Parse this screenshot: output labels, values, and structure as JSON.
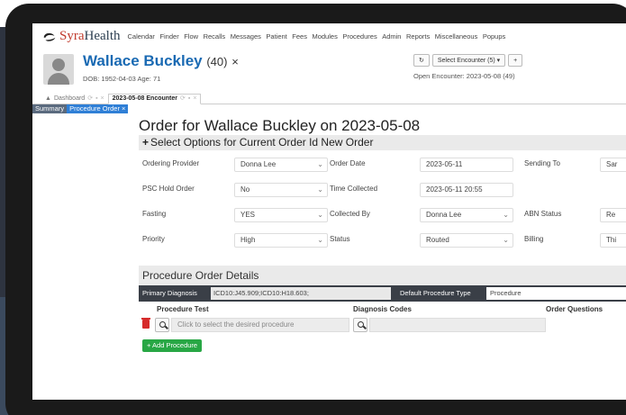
{
  "brand": {
    "syra": "Syra",
    "health": "Health"
  },
  "menu": [
    "Calendar",
    "Finder",
    "Flow",
    "Recalls",
    "Messages",
    "Patient",
    "Fees",
    "Modules",
    "Procedures",
    "Admin",
    "Reports",
    "Miscellaneous",
    "Popups"
  ],
  "patient": {
    "name": "Wallace Buckley",
    "age": "(40)",
    "close": "×",
    "dob": "DOB: 1952-04-03 Age: 71"
  },
  "encounter": {
    "select_label": "Select Encounter (5) ▾",
    "plus": "+",
    "open": "Open Encounter: 2023-05-08 (49)"
  },
  "tabs": [
    {
      "label": "Dashboard"
    },
    {
      "label": "2023-05-08 Encounter"
    }
  ],
  "subtabs": [
    "Summary",
    "Procedure Order ×"
  ],
  "order": {
    "title": "Order for Wallace Buckley on 2023-05-08",
    "section1": "Select Options for Current Order Id New Order",
    "fields": {
      "ordering_provider": {
        "label": "Ordering Provider",
        "value": "Donna Lee"
      },
      "order_date": {
        "label": "Order Date",
        "value": "2023-05-11"
      },
      "sending_to": {
        "label": "Sending To",
        "value": "Sar"
      },
      "psc_hold": {
        "label": "PSC Hold Order",
        "value": "No"
      },
      "time_collected": {
        "label": "Time Collected",
        "value": "2023-05-11 20:55"
      },
      "fasting": {
        "label": "Fasting",
        "value": "YES"
      },
      "collected_by": {
        "label": "Collected By",
        "value": "Donna Lee"
      },
      "abn_status": {
        "label": "ABN Status",
        "value": "Re"
      },
      "priority": {
        "label": "Priority",
        "value": "High"
      },
      "status": {
        "label": "Status",
        "value": "Routed"
      },
      "billing": {
        "label": "Billing",
        "value": "Thi"
      }
    },
    "section2": "Procedure Order Details",
    "primary_diagnosis": {
      "label": "Primary Diagnosis",
      "value": "ICD10:J45.909;ICD10:H18.603;"
    },
    "default_type": {
      "label": "Default Procedure Type",
      "value": "Procedure"
    },
    "columns": [
      "Procedure Test",
      "Diagnosis Codes",
      "Order Questions"
    ],
    "procedure_placeholder": "Click to select the desired procedure",
    "add_button": "+ Add Procedure"
  },
  "colors": {
    "accent": "#2f7fd6",
    "add": "#28a745",
    "delete": "#d62b2b"
  }
}
